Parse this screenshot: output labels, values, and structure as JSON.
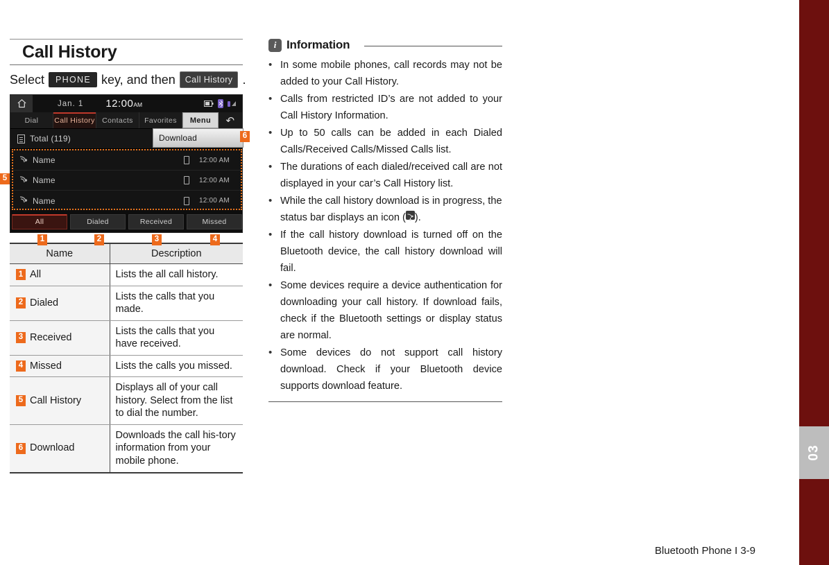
{
  "page": {
    "title": "Call History",
    "footer": "Bluetooth Phone I 3-9",
    "edge_tab_label": "03"
  },
  "intro": {
    "prefix": "Select",
    "key_chip": "PHONE",
    "middle": "key, and then",
    "button_chip": "Call History",
    "suffix": "."
  },
  "device": {
    "home_icon": "home-icon",
    "date": "Jan. 1",
    "time": "12:00",
    "ampm": "AM",
    "status_icons": [
      "battery-icon",
      "bluetooth-icon",
      "signal-icon"
    ],
    "tabs": [
      {
        "label": "Dial",
        "active": false
      },
      {
        "label": "Call History",
        "active": true
      },
      {
        "label": "Contacts",
        "active": false
      },
      {
        "label": "Favorites",
        "active": false
      }
    ],
    "menu_label": "Menu",
    "back_icon": "back-arrow-icon",
    "total_label": "Total (119)",
    "download_label": "Download",
    "download_badge": "6",
    "list_badge": "5",
    "rows": [
      {
        "name": "Name",
        "time": "12:00 AM"
      },
      {
        "name": "Name",
        "time": "12:00 AM"
      },
      {
        "name": "Name",
        "time": "12:00 AM"
      }
    ],
    "bottom_tabs": [
      {
        "label": "All",
        "badge": "1",
        "active": true
      },
      {
        "label": "Dialed",
        "badge": "2",
        "active": false
      },
      {
        "label": "Received",
        "badge": "3",
        "active": false
      },
      {
        "label": "Missed",
        "badge": "4",
        "active": false
      }
    ]
  },
  "table": {
    "headers": {
      "name": "Name",
      "description": "Description"
    },
    "rows": [
      {
        "badge": "1",
        "name": "All",
        "description": "Lists the all call history."
      },
      {
        "badge": "2",
        "name": "Dialed",
        "description": "Lists the calls that you made."
      },
      {
        "badge": "3",
        "name": "Received",
        "description": "Lists the calls that you have received."
      },
      {
        "badge": "4",
        "name": "Missed",
        "description": "Lists the calls you missed."
      },
      {
        "badge": "5",
        "name": "Call History",
        "description": "Displays all of your call history. Select from the list to dial the number."
      },
      {
        "badge": "6",
        "name": "Download",
        "description": "Downloads the call his-tory information from your mobile phone."
      }
    ]
  },
  "information": {
    "icon": "info-icon",
    "title": "Information",
    "bullets": [
      {
        "text": "In some mobile phones, call records may not be added to your Call History.",
        "has_icon": false
      },
      {
        "text": "Calls from restricted ID’s are not added to your Call History Information.",
        "has_icon": false
      },
      {
        "text": "Up to 50 calls can be added in each Dialed Calls/Received Calls/Missed Calls list.",
        "has_icon": false
      },
      {
        "text": "The durations of each dialed/received call are not displayed in your car’s Call History list.",
        "has_icon": false
      },
      {
        "text_before": "While the call history download is in progress, the status bar displays an icon (",
        "text_after": ").",
        "has_icon": true,
        "icon_name": "download-status-icon"
      },
      {
        "text": "If the call history download is turned off on the Bluetooth device, the call history download will fail.",
        "has_icon": false
      },
      {
        "text": "Some devices require a device authentication for downloading your call history. If download fails, check if the Bluetooth settings or display status are normal.",
        "has_icon": false
      },
      {
        "text": "Some devices do not support call history download. Check if your Bluetooth device supports download feature.",
        "has_icon": false
      }
    ]
  },
  "colors": {
    "badge_orange": "#ed6a1c",
    "edge_red": "#6d100e",
    "edge_tab_gray": "#bdbdbd",
    "device_accent": "#c0392b"
  }
}
